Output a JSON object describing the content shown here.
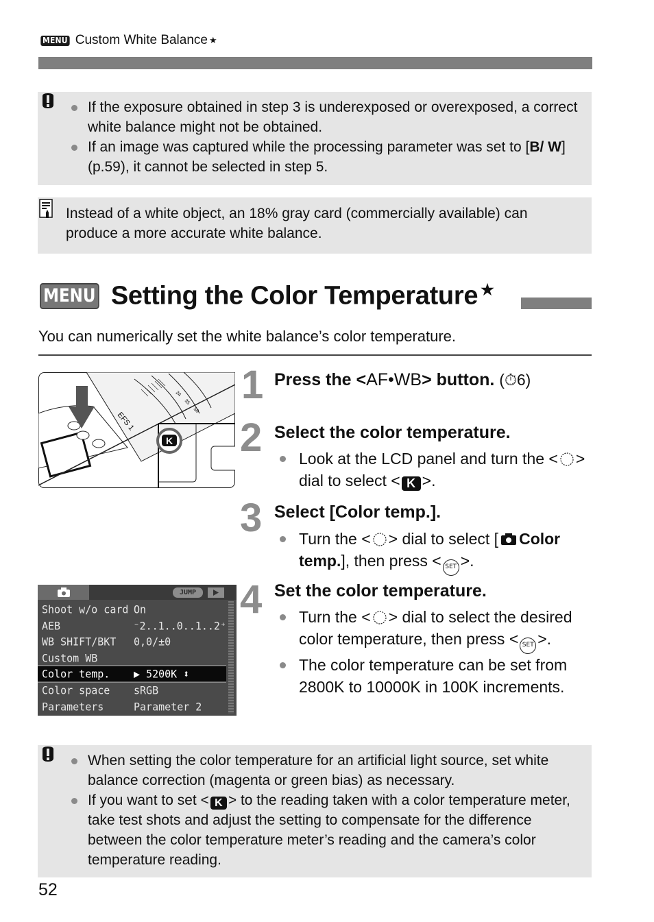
{
  "header": {
    "menu_badge": "MENU",
    "title": "Custom White Balance",
    "star": "★"
  },
  "caution_box_1": {
    "icon": "caution-icon",
    "items": [
      "If the exposure obtained in step 3 is underexposed or overexposed, a correct white balance might not be obtained.",
      {
        "pre": "If an image was captured while the processing parameter was set to [",
        "bold": "B/ W",
        "post": "] (p.59), it cannot be selected in step 5."
      }
    ]
  },
  "memo_box": {
    "icon": "memo-icon",
    "text": "Instead of a white object, an 18% gray card (commercially available) can produce a more accurate white balance."
  },
  "section": {
    "menu_badge": "MENU",
    "title": "Setting the Color Temperature",
    "star": "★",
    "intro": "You can numerically set the white balance’s color temperature."
  },
  "steps": [
    {
      "number": "1",
      "heading_pre": "Press the <",
      "heading_button": "AF•WB",
      "heading_post": "> button.",
      "timer_ref": "(⏱6)"
    },
    {
      "number": "2",
      "heading": "Select the color temperature.",
      "bullet": {
        "t1": "Look at the LCD panel and turn the <",
        "t2": "> dial to select <",
        "k": "K",
        "t3": ">."
      }
    },
    {
      "number": "3",
      "heading": "Select [Color temp.].",
      "bullet": {
        "t1": "Turn the <",
        "t2": "> dial to select [",
        "bold": "Color temp.",
        "t3": "], then press <",
        "set": "SET",
        "t4": ">."
      }
    },
    {
      "number": "4",
      "heading": "Set the color temperature.",
      "bullets": [
        {
          "t1": "Turn the <",
          "t2": "> dial to select the desired color temperature, then press <",
          "set": "SET",
          "t3": ">."
        },
        {
          "text": "The color temperature can be set from 2800K to 10000K in 100K increments."
        }
      ]
    }
  ],
  "camera_illustration": {
    "k_label": "K",
    "lens_marks": [
      "24",
      "35",
      "50"
    ],
    "lens_label": "EFS 1"
  },
  "lcd_menu": {
    "jump_label": "JUMP",
    "rows": [
      {
        "key": "Shoot w/o card",
        "value": "On"
      },
      {
        "key": "AEB",
        "value": "⁻2..1..0..1..2⁺"
      },
      {
        "key": "WB SHIFT/BKT",
        "value": "0,0/±0"
      },
      {
        "key": "Custom WB",
        "value": ""
      },
      {
        "key": "Color temp.",
        "value": "▶ 5200K ⬍",
        "selected": true
      },
      {
        "key": "Color space",
        "value": "sRGB"
      },
      {
        "key": "Parameters",
        "value": "Parameter 2"
      }
    ]
  },
  "caution_box_2": {
    "icon": "caution-icon",
    "items": [
      "When setting the color temperature for an artificial light source, set white balance correction (magenta or green bias) as necessary.",
      {
        "pre": "If you want to set <",
        "k": "K",
        "post": "> to the reading taken with a color temperature meter, take test shots and adjust the setting to compensate for the difference between the color temperature meter’s reading and the camera’s color temperature reading."
      }
    ]
  },
  "page_number": "52"
}
